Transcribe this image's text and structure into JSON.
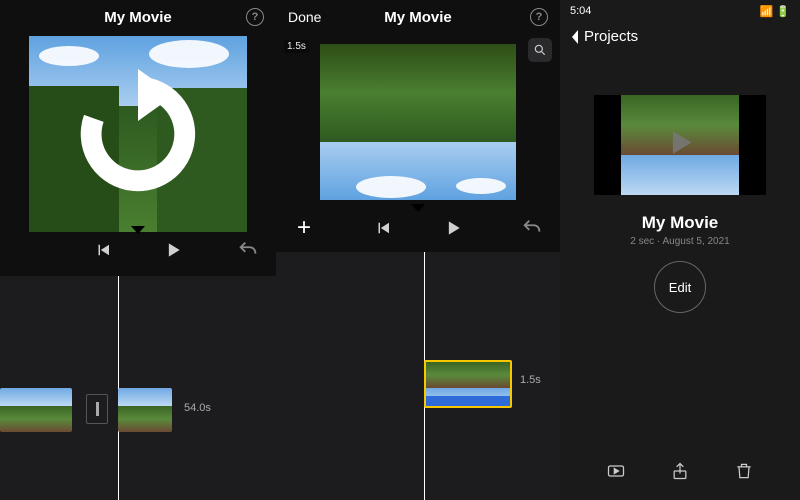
{
  "panel1": {
    "title": "My Movie",
    "help": "?",
    "clip_duration": "54.0s",
    "rotate_icon": "rotate-cw-icon"
  },
  "panel2": {
    "done": "Done",
    "title": "My Movie",
    "help": "?",
    "preview_duration": "1.5s",
    "clip_duration": "1.5s"
  },
  "panel3": {
    "status_time": "5:04",
    "back_label": "Projects",
    "project_title": "My Movie",
    "project_meta": "2 sec · August 5, 2021",
    "edit_label": "Edit"
  }
}
